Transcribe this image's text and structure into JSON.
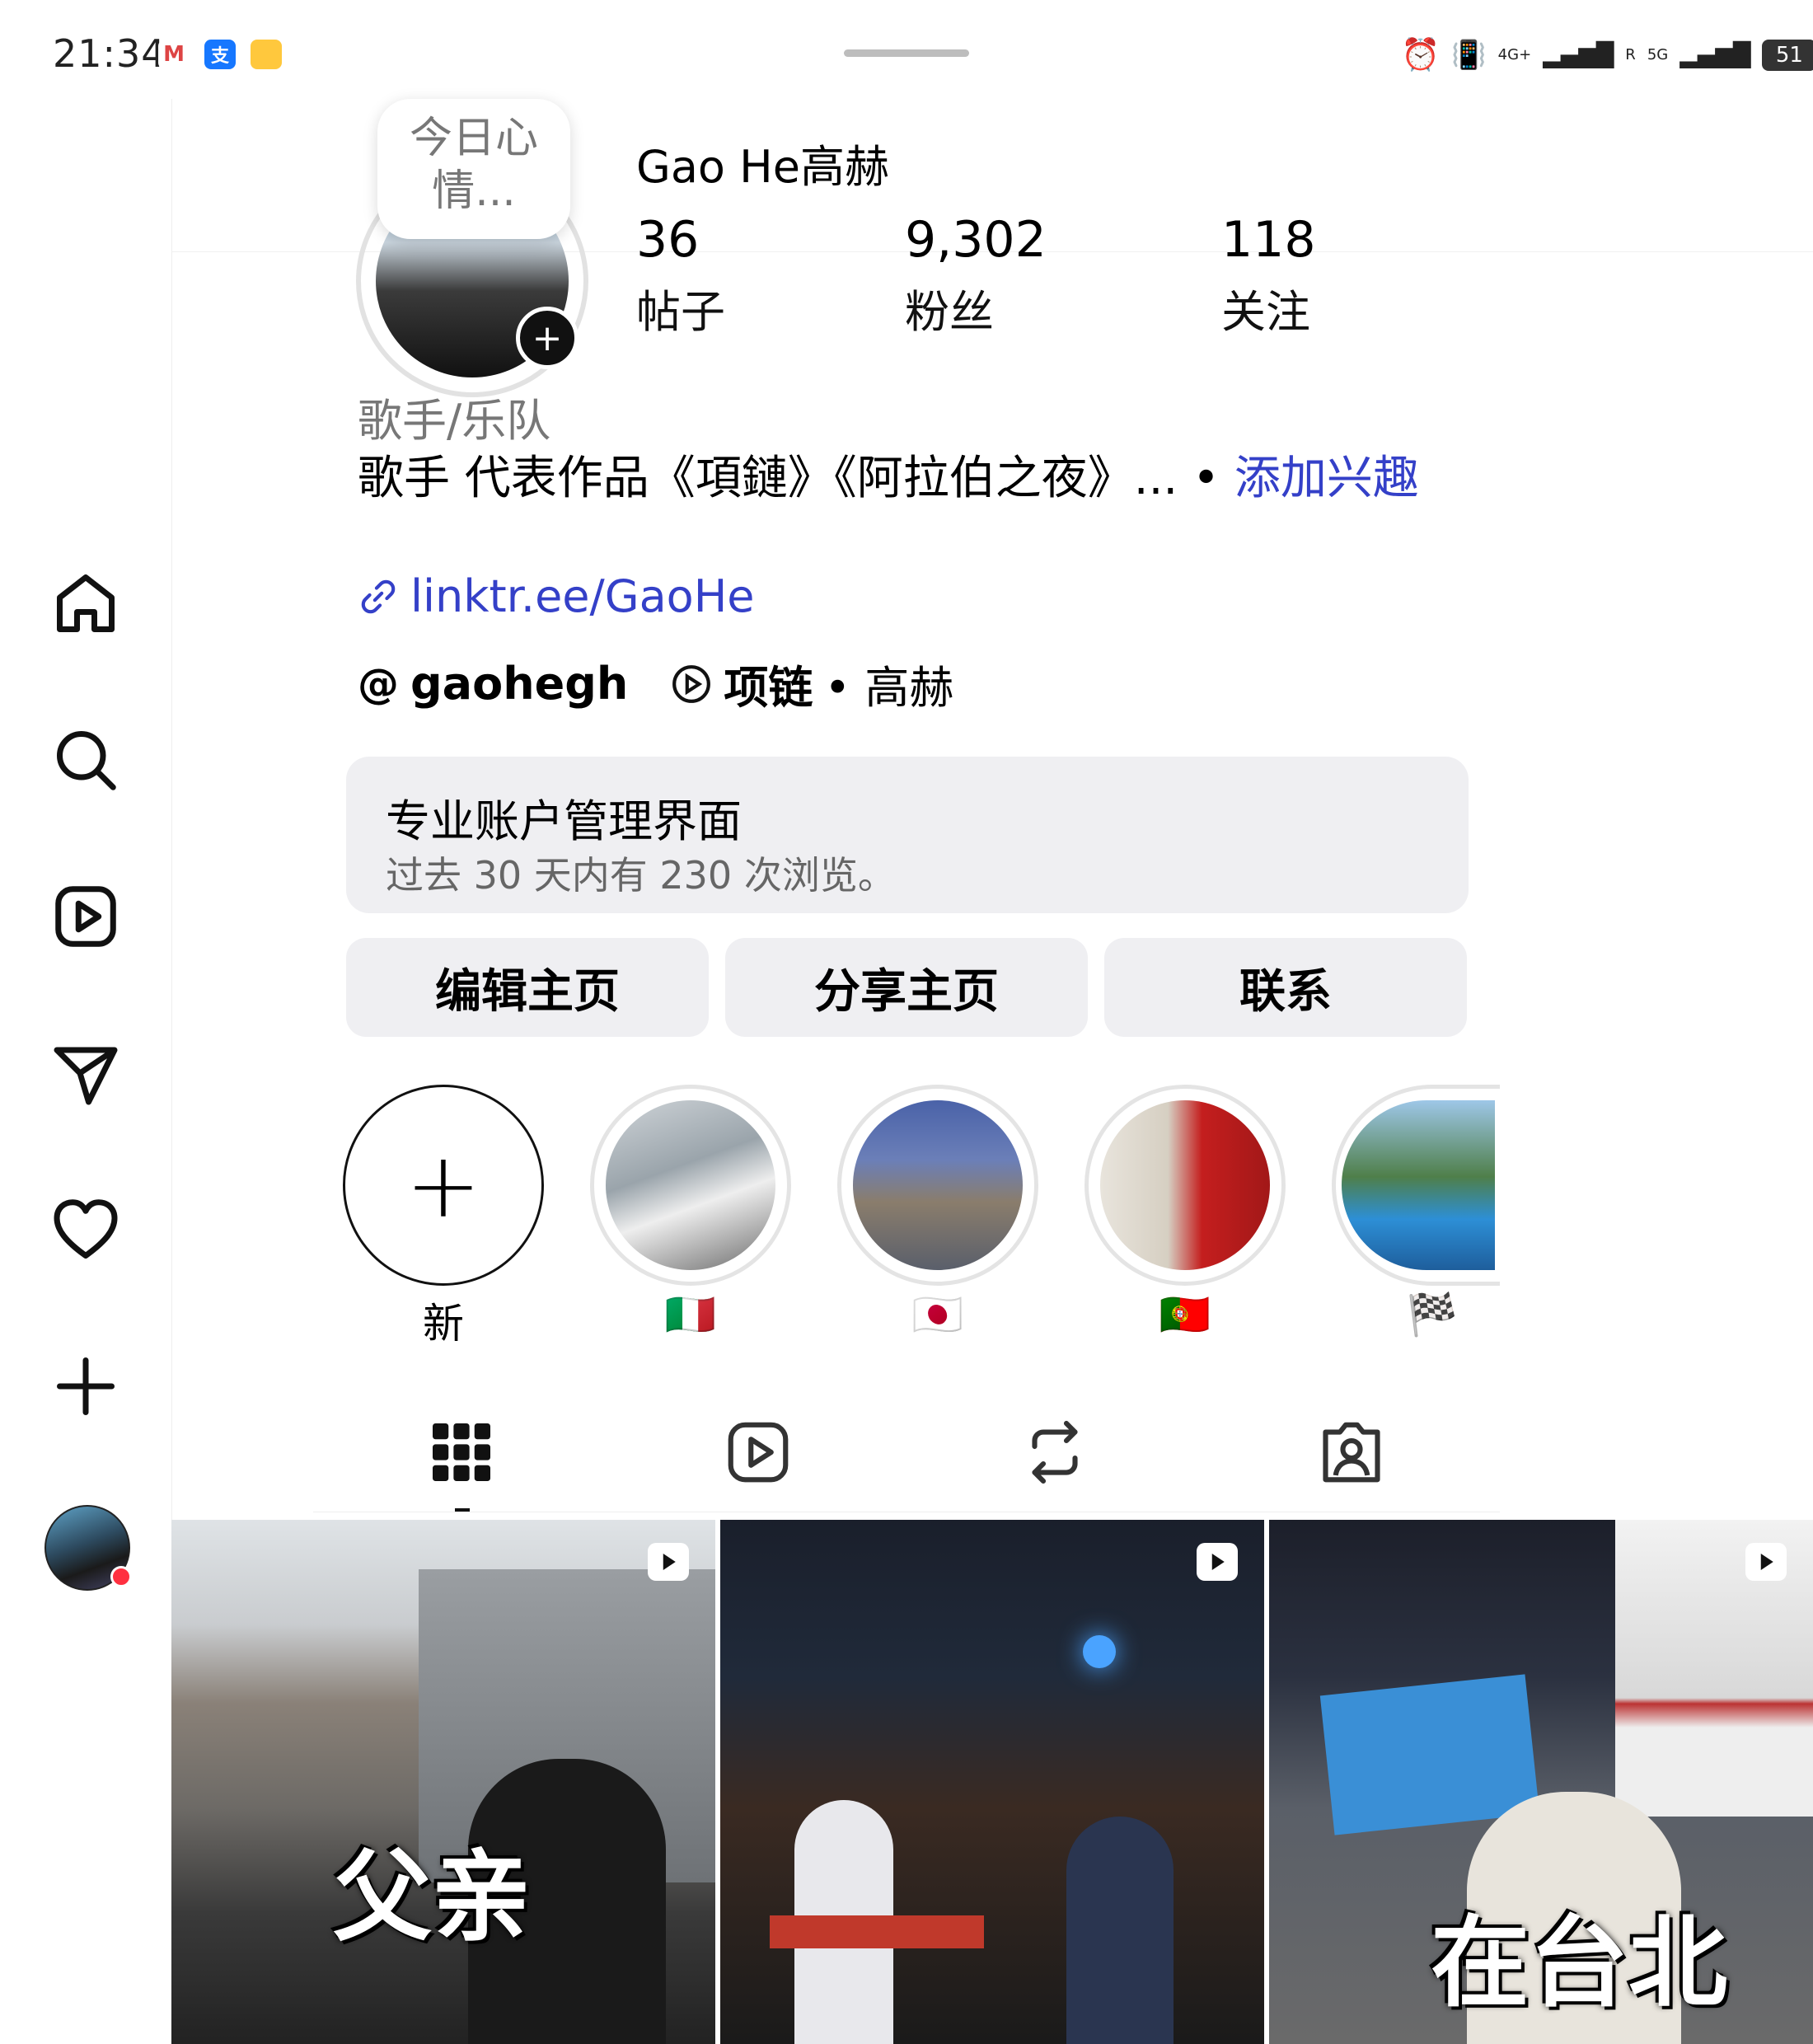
{
  "status_bar": {
    "time": "21:34",
    "network_1": "4G+",
    "network_2": "5G",
    "roaming": "R",
    "battery": "51"
  },
  "profile": {
    "note": "今日心情...",
    "username": "Gao He高赫",
    "stats": [
      {
        "value": "36",
        "label": "帖子"
      },
      {
        "value": "9,302",
        "label": "粉丝"
      },
      {
        "value": "118",
        "label": "关注"
      }
    ],
    "category": "歌手/乐队",
    "bio": "歌手 代表作品《項鏈》《阿拉伯之夜》... • ",
    "add_interest": "添加兴趣",
    "link": "linktr.ee/GaoHe",
    "threads_handle": "gaohegh",
    "music_title": "项链",
    "music_artist": "• 高赫"
  },
  "dashboard": {
    "title": "专业账户管理界面",
    "subtitle": "过去 30 天内有 230 次浏览。"
  },
  "buttons": {
    "edit": "编辑主页",
    "share": "分享主页",
    "contact": "联系"
  },
  "highlights": [
    {
      "label": "新"
    },
    {
      "label": "🇮🇹"
    },
    {
      "label": "🇯🇵"
    },
    {
      "label": "🇵🇹"
    },
    {
      "label": "🏁"
    }
  ],
  "posts": [
    {
      "caption": "父亲"
    },
    {
      "caption": ""
    },
    {
      "caption": "在台北"
    }
  ],
  "colors": {
    "link_blue": "#3440c8",
    "button_bg": "#efeff2",
    "notification_red": "#ff3040"
  }
}
